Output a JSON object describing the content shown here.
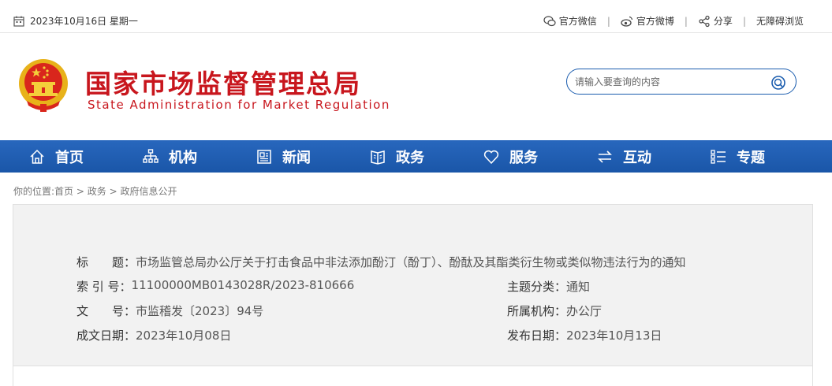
{
  "topbar": {
    "date": "2023年10月16日 星期一",
    "wechat": "官方微信",
    "weibo": "官方微博",
    "share": "分享",
    "accessible": "无障碍浏览",
    "separator": "|"
  },
  "header": {
    "title_cn": "国家市场监督管理总局",
    "title_en": "State Administration for Market Regulation"
  },
  "search": {
    "placeholder": "请输入要查询的内容"
  },
  "nav": [
    {
      "label": "首页",
      "icon": "home-icon"
    },
    {
      "label": "机构",
      "icon": "org-icon"
    },
    {
      "label": "新闻",
      "icon": "news-icon"
    },
    {
      "label": "政务",
      "icon": "government-icon"
    },
    {
      "label": "服务",
      "icon": "heart-icon"
    },
    {
      "label": "互动",
      "icon": "exchange-icon"
    },
    {
      "label": "专题",
      "icon": "topic-list-icon"
    }
  ],
  "breadcrumb": {
    "prefix": "你的位置:",
    "items": [
      "首页",
      "政务",
      "政府信息公开"
    ],
    "sep": ">"
  },
  "info": {
    "title_label": "标　　题：",
    "title_value": "市场监管总局办公厅关于打击食品中非法添加酚汀（酚丁）、酚酞及其酯类衍生物或类似物违法行为的通知",
    "index_label": "索 引 号：",
    "index_value": "11100000MB0143028R/2023-810666",
    "category_label": "主题分类：",
    "category_value": "通知",
    "docno_label": "文　　号：",
    "docno_value": "市监稽发〔2023〕94号",
    "org_label": "所属机构：",
    "org_value": "办公厅",
    "created_label": "成文日期：",
    "created_value": "2023年10月08日",
    "published_label": "发布日期：",
    "published_value": "2023年10月13日"
  },
  "colors": {
    "brand_red": "#c8161d",
    "nav_blue": "#1f5db3",
    "info_bg": "#f2f2f2"
  }
}
